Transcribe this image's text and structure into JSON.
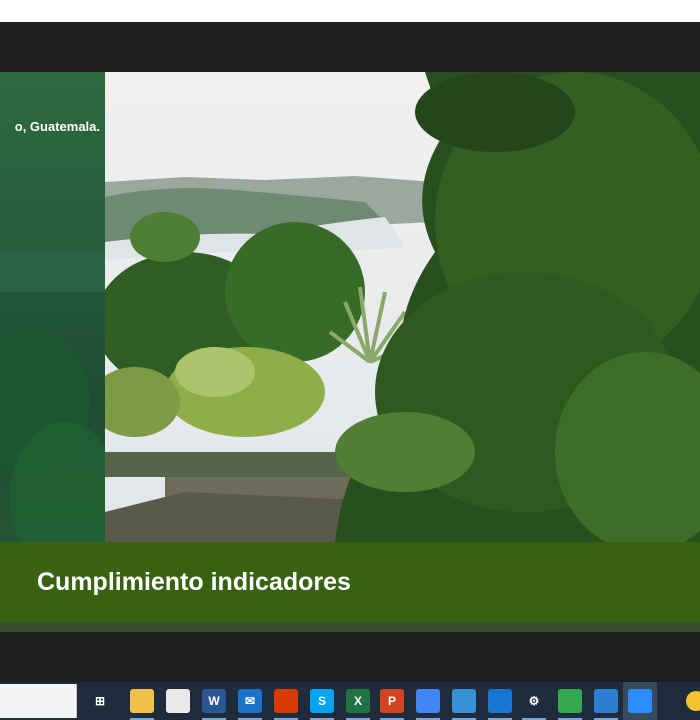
{
  "slide": {
    "caption": "o, Guatemala.",
    "title": "Cumplimiento indicadores"
  },
  "taskbar": {
    "icons": [
      {
        "name": "task-view-icon",
        "glyph": "⊞",
        "color": "#202c3c"
      },
      {
        "name": "file-explorer-icon",
        "glyph": "",
        "color": "#f0c24a"
      },
      {
        "name": "store-icon",
        "glyph": "",
        "color": "#e9e9e9"
      },
      {
        "name": "word-icon",
        "glyph": "W",
        "color": "#2b5797"
      },
      {
        "name": "mail-icon",
        "glyph": "✉",
        "color": "#1a73c8"
      },
      {
        "name": "office-icon",
        "glyph": "",
        "color": "#d83b01"
      },
      {
        "name": "skype-icon",
        "glyph": "S",
        "color": "#00a4ef"
      },
      {
        "name": "excel-icon",
        "glyph": "X",
        "color": "#217346"
      },
      {
        "name": "powerpoint-icon",
        "glyph": "P",
        "color": "#d04423"
      },
      {
        "name": "chrome-icon",
        "glyph": "",
        "color": "#4285f4"
      },
      {
        "name": "laptop-icon",
        "glyph": "",
        "color": "#3a8fd9"
      },
      {
        "name": "calendar-icon",
        "glyph": "",
        "color": "#1976d2"
      },
      {
        "name": "settings-icon",
        "glyph": "⚙",
        "color": "#202c3c"
      },
      {
        "name": "chrome-profile-icon",
        "glyph": "",
        "color": "#34a853"
      },
      {
        "name": "photos-icon",
        "glyph": "",
        "color": "#2d7dd2"
      },
      {
        "name": "zoom-icon",
        "glyph": "",
        "color": "#2d8cff"
      },
      {
        "name": "weather-icon",
        "glyph": "",
        "color": "#f4c430"
      }
    ]
  }
}
